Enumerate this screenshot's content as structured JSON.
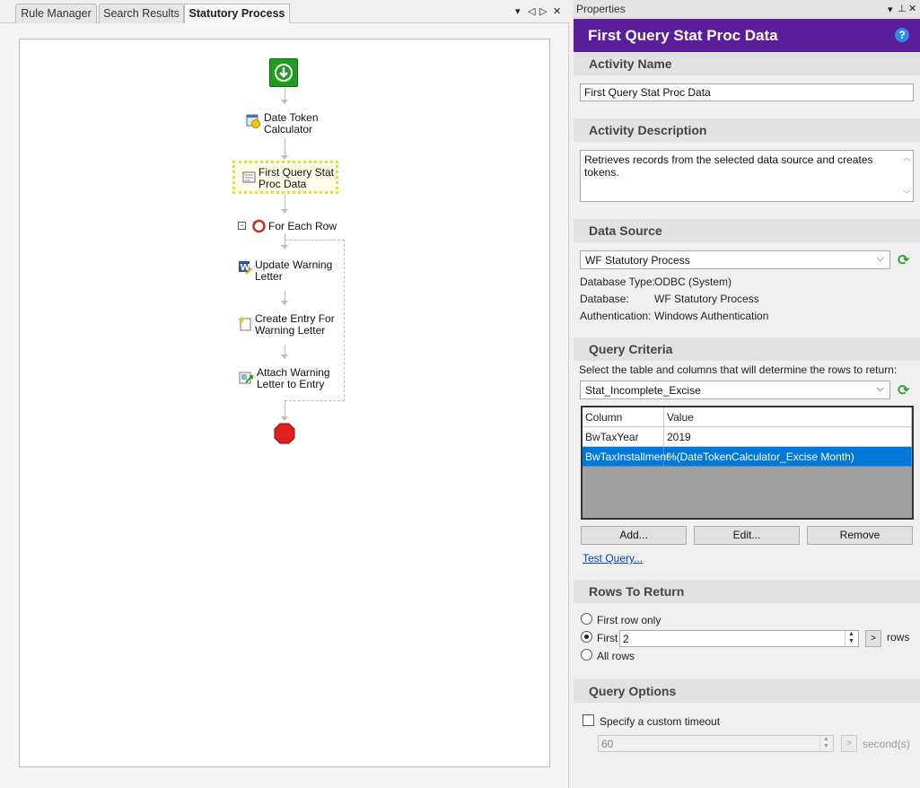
{
  "left_pane": {
    "tabs": [
      {
        "label": "Rule Manager"
      },
      {
        "label": "Search Results"
      },
      {
        "label": "Statutory Process"
      }
    ],
    "controls": {
      "dropdown": "▾",
      "prev": "◁",
      "next": "▷",
      "close": "✕"
    },
    "workflow": {
      "start_icon": "green-start-arrow-icon",
      "nodes": [
        {
          "line1": "Date Token",
          "line2": "Calculator",
          "icon": "date-token-calculator-icon"
        },
        {
          "line1": "First Query Stat",
          "line2": "Proc Data",
          "icon": "query-icon",
          "selected": true
        },
        {
          "line1": "For Each Row",
          "icon": "loop-icon",
          "collapse": "⊟"
        },
        {
          "line1": "Update Warning",
          "line2": "Letter",
          "icon": "word-document-icon"
        },
        {
          "line1": "Create Entry For",
          "line2": "Warning Letter",
          "icon": "new-entry-icon"
        },
        {
          "line1": "Attach Warning",
          "line2": "Letter to Entry",
          "icon": "attach-icon"
        }
      ],
      "end_icon": "red-stop-icon"
    }
  },
  "properties": {
    "panel_title": "Properties",
    "panel_controls": {
      "dropdown": "▾",
      "pin": "⊥",
      "close": "✕"
    },
    "header_title": "First Query Stat Proc Data",
    "help": "?",
    "activity_name": {
      "heading": "Activity Name",
      "value": "First Query Stat Proc Data"
    },
    "activity_description": {
      "heading": "Activity Description",
      "value": "Retrieves records from the selected data source and creates tokens."
    },
    "data_source": {
      "heading": "Data Source",
      "selected": "WF Statutory Process",
      "details": [
        {
          "label": "Database Type:",
          "value": "ODBC (System)"
        },
        {
          "label": "Database:",
          "value": "WF Statutory Process"
        },
        {
          "label": "Authentication:",
          "value": "Windows Authentication"
        }
      ]
    },
    "query_criteria": {
      "heading": "Query Criteria",
      "instruction": "Select the table and columns that will determine the rows to return:",
      "table": "Stat_Incomplete_Excise",
      "columns": [
        "Column",
        "Value"
      ],
      "rows": [
        [
          "BwTaxYear",
          "2019"
        ],
        [
          "BwTaxInstallment",
          "%(DateTokenCalculator_Excise Month)"
        ]
      ],
      "buttons": {
        "add": "Add...",
        "edit": "Edit...",
        "remove": "Remove"
      },
      "test_query": "Test Query..."
    },
    "rows_to_return": {
      "heading": "Rows To Return",
      "options": {
        "first_row_only": "First row only",
        "first": "First",
        "all_rows": "All rows"
      },
      "selected": "first",
      "first_count": "2",
      "arrow_btn": ">",
      "unit": "rows"
    },
    "query_options": {
      "heading": "Query Options",
      "custom_timeout_label": "Specify a custom timeout",
      "custom_timeout_checked": false,
      "timeout_value": "60",
      "arrow_btn": ">",
      "unit": "second(s)"
    },
    "colors": {
      "header": "#5a1e9c",
      "selection": "#0078d7"
    }
  }
}
